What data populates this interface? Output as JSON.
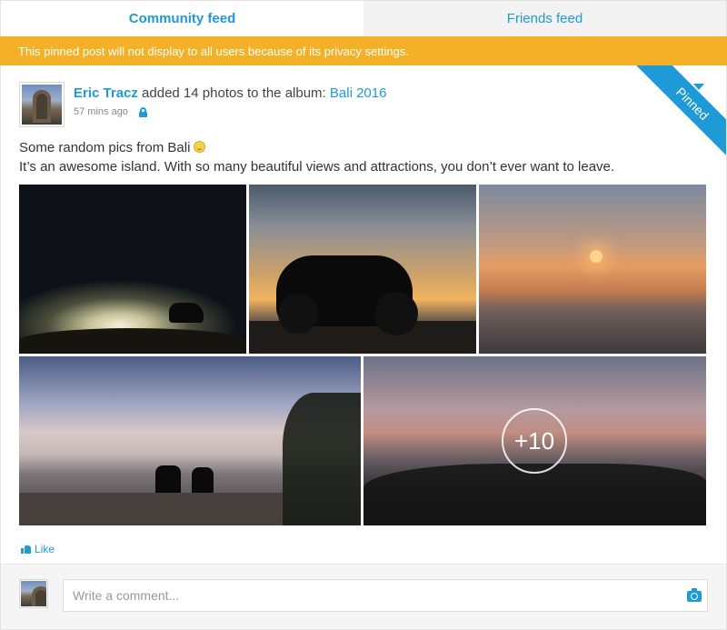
{
  "tabs": [
    {
      "label": "Community feed",
      "active": true
    },
    {
      "label": "Friends feed",
      "active": false
    }
  ],
  "notice": "This pinned post will not display to all users because of its privacy settings.",
  "post": {
    "pinned_label": "Pinned",
    "author": "Eric Tracz",
    "action": " added 14 photos to the album: ",
    "album": "Bali 2016",
    "time": "57 mins ago",
    "text_line1": "Some random pics from Bali",
    "text_line2": "It’s an awesome island. With so many beautiful views and attractions, you don’t ever want to leave.",
    "more_photos": "+10",
    "like_label": "Like"
  },
  "comment": {
    "placeholder": "Write a comment..."
  },
  "colors": {
    "accent": "#1e9ad6",
    "notice_bg": "#f4b026"
  },
  "icons": [
    "lock-icon",
    "smile-emoji-icon",
    "like-thumb-icon",
    "camera-icon",
    "chevron-down-icon"
  ]
}
